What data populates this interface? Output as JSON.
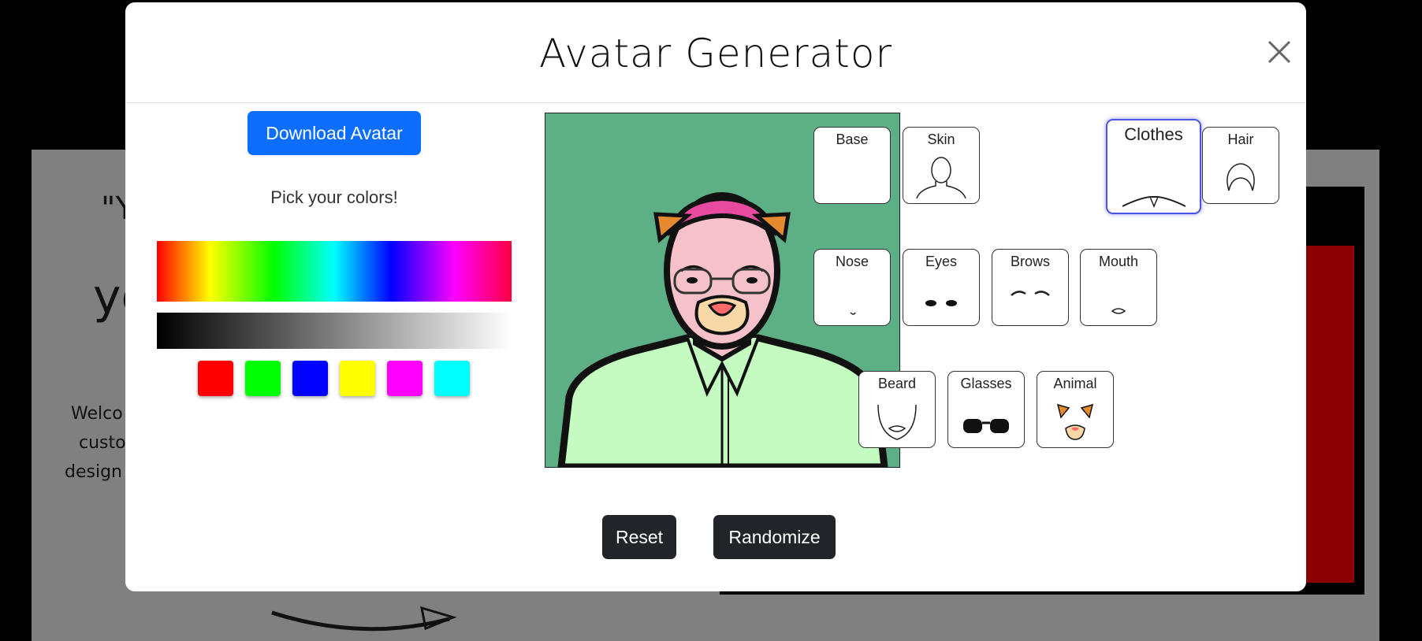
{
  "background": {
    "quote_fragment": "\"Y",
    "big_fragment": "yo",
    "text_lines": [
      "Welco",
      "custo",
      "design"
    ]
  },
  "modal": {
    "title": "Avatar Generator",
    "download_label": "Download Avatar",
    "pick_colors_label": "Pick your colors!",
    "swatches": [
      "#ff0000",
      "#00ff00",
      "#0000ff",
      "#ffff00",
      "#ff00ff",
      "#00ffff"
    ],
    "parts": [
      {
        "label": "Base",
        "icon": "blank-icon"
      },
      {
        "label": "Skin",
        "icon": "skin-outline-icon"
      },
      {
        "label": "Clothes",
        "icon": "clothes-icon",
        "selected": true
      },
      {
        "label": "Hair",
        "icon": "hair-icon"
      },
      {
        "label": "Nose",
        "icon": "nose-icon"
      },
      {
        "label": "Eyes",
        "icon": "eyes-icon"
      },
      {
        "label": "Brows",
        "icon": "brows-icon"
      },
      {
        "label": "Mouth",
        "icon": "mouth-icon"
      },
      {
        "label": "Beard",
        "icon": "beard-icon"
      },
      {
        "label": "Glasses",
        "icon": "glasses-icon"
      },
      {
        "label": "Animal",
        "icon": "animal-icon"
      }
    ],
    "reset_label": "Reset",
    "randomize_label": "Randomize",
    "preview_background": "#5db085",
    "skin_color": "#f6c1c8",
    "hair_color": "#e84aa0",
    "shirt_color": "#c4fbc0"
  }
}
